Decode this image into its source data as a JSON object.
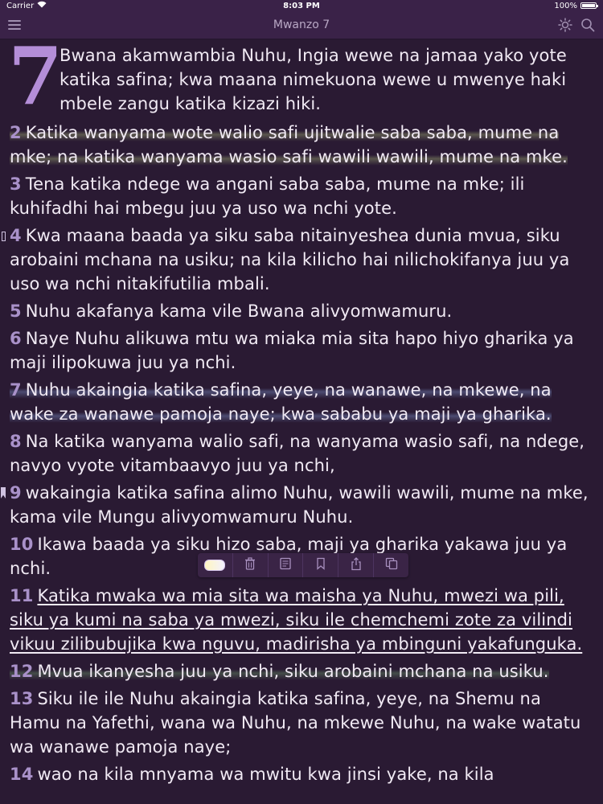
{
  "status": {
    "carrier": "Carrier",
    "time": "8:03 PM",
    "battery": "100%",
    "battery_level": 1.0
  },
  "nav": {
    "title": "Mwanzo 7"
  },
  "chapter": {
    "number": "7"
  },
  "verses": [
    {
      "num": "",
      "text": "Bwana akamwambia Nuhu, Ingia wewe na jamaa yako yote katika safina; kwa maana nimekuona wewe u mwenye haki mbele zangu katika kizazi hiki."
    },
    {
      "num": "2",
      "text": "Katika wanyama wote walio safi ujitwalie saba saba, mume na mke; na katika wanyama wasio safi wawili wawili, mume na mke."
    },
    {
      "num": "3",
      "text": "Tena katika ndege wa angani saba saba, mume na mke; ili kuhifadhi hai mbegu juu ya uso wa nchi yote."
    },
    {
      "num": "4",
      "text": "Kwa maana baada ya siku saba nitainyeshea dunia mvua, siku arobaini mchana na usiku; na kila kilicho hai nilichokifanya juu ya uso wa nchi nitakifutilia mbali."
    },
    {
      "num": "5",
      "text": "Nuhu akafanya kama vile Bwana alivyomwamuru."
    },
    {
      "num": "6",
      "text": "Naye Nuhu alikuwa mtu wa miaka mia sita hapo hiyo gharika ya maji ilipokuwa juu ya nchi."
    },
    {
      "num": "7",
      "text": "Nuhu akaingia katika safina, yeye, na wanawe, na mkewe, na wake za wanawe pamoja naye; kwa sababu ya maji ya gharika."
    },
    {
      "num": "8",
      "text": "Na katika wanyama walio safi, na wanyama wasio safi, na ndege, navyo vyote vitambaavyo juu ya nchi,"
    },
    {
      "num": "9",
      "text": "wakaingia katika safina alimo Nuhu, wawili wawili, mume na mke, kama vile Mungu alivyomwamuru Nuhu."
    },
    {
      "num": "10",
      "text": "Ikawa baada ya siku hizo saba, maji ya gharika yakawa juu ya nchi."
    },
    {
      "num": "11",
      "text": "Katika mwaka wa mia sita wa maisha ya Nuhu, mwezi wa pili, siku ya kumi na saba ya mwezi, siku ile chemchemi zote za vilindi vikuu zilibubujika kwa nguvu, madirisha ya mbinguni yakafunguka."
    },
    {
      "num": "12",
      "text": "Mvua ikanyesha juu ya nchi, siku arobaini mchana na usiku."
    },
    {
      "num": "13",
      "text": "Siku ile ile Nuhu akaingia katika safina, yeye, na Shemu na Hamu na Yafethi, wana wa Nuhu, na mkewe Nuhu, na wake watatu wa wanawe pamoja naye;"
    },
    {
      "num": "14",
      "text": "wao na kila mnyama wa mwitu kwa jinsi yake, na kila"
    }
  ],
  "icons": {
    "menu": "menu-icon",
    "brightness": "sun-icon",
    "search": "search-icon",
    "toolbar": [
      "color-toggle",
      "trash-icon",
      "note-icon",
      "bookmark-icon",
      "share-icon",
      "copy-icon"
    ]
  }
}
